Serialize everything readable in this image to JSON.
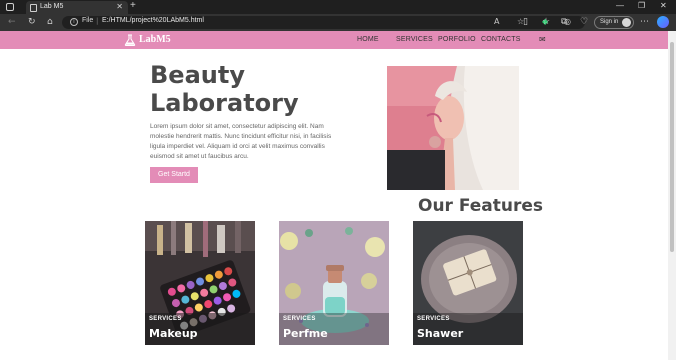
{
  "browser": {
    "tab_title": "Lab M5",
    "tab_close": "✕",
    "new_tab": "+",
    "address_scheme": "File",
    "address_url": "E:/HTML/project%20LAbM5.html",
    "signin_label": "Sign in",
    "window_controls": [
      "—",
      "❐",
      "✕"
    ]
  },
  "nav": {
    "logo": "LabM5",
    "links": [
      "HOME",
      "SERVICES",
      "PORFOLIO",
      "CONTACTS"
    ],
    "mail_icon": "✉",
    "color": "#e38cb7"
  },
  "hero": {
    "title_line1": "Beauty",
    "title_line2": "Laboratory",
    "text": "Lorem ipsum dolor sit amet, consectetur adipiscing elit. Nam molestie hendrerit mattis. Nunc tincidunt efficitur nisi, in facilisis ligula imperdiet vel. Aliquam id orci at velit maximus convallis euismod sit amet ut faucibus arcu.",
    "button_label": "Get Startd"
  },
  "features": {
    "title": "Our Features",
    "cards": [
      {
        "label": "SERVICES",
        "title": "Makeup"
      },
      {
        "label": "SERVICES",
        "title": "Perfme"
      },
      {
        "label": "SERVICES",
        "title": "Shawer"
      }
    ]
  }
}
